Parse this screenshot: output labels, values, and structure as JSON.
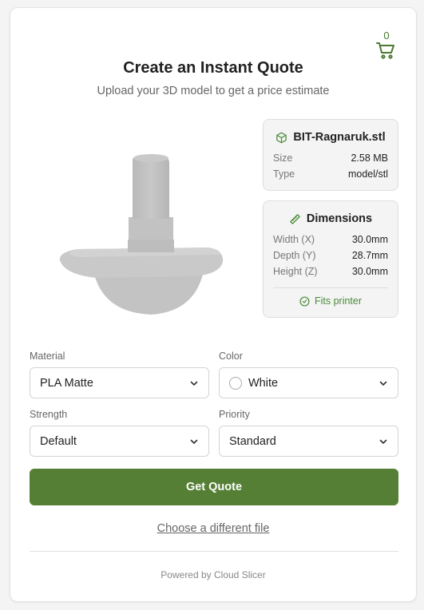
{
  "cart": {
    "count": "0",
    "icon": "cart-icon",
    "color": "#4b7a30"
  },
  "header": {
    "title": "Create an Instant Quote",
    "subtitle": "Upload your 3D model to get a price estimate"
  },
  "file": {
    "icon": "cube-icon",
    "name": "BIT-Ragnaruk.stl",
    "size_label": "Size",
    "size_value": "2.58 MB",
    "type_label": "Type",
    "type_value": "model/stl"
  },
  "dimensions": {
    "icon": "ruler-icon",
    "heading": "Dimensions",
    "width_label": "Width (X)",
    "width_value": "30.0mm",
    "depth_label": "Depth (Y)",
    "depth_value": "28.7mm",
    "height_label": "Height (Z)",
    "height_value": "30.0mm",
    "fit_status": "Fits printer",
    "fit_icon": "check-circle-icon",
    "fit_color": "#4b8a3a"
  },
  "form": {
    "material_label": "Material",
    "material_value": "PLA Matte",
    "color_label": "Color",
    "color_value": "White",
    "strength_label": "Strength",
    "strength_value": "Default",
    "priority_label": "Priority",
    "priority_value": "Standard"
  },
  "actions": {
    "quote_button": "Get Quote",
    "quote_button_color": "#557f34",
    "change_file_link": "Choose a different file"
  },
  "footer": {
    "powered_by": "Powered by Cloud Slicer"
  }
}
